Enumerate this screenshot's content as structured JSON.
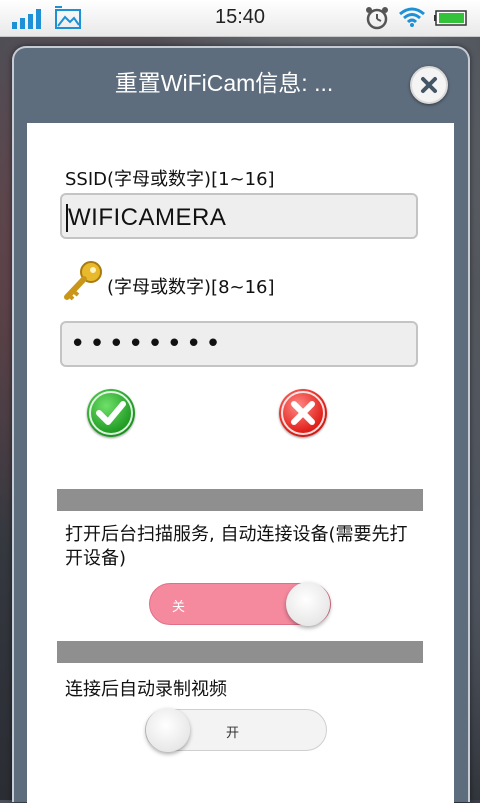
{
  "status_bar": {
    "time": "15:40",
    "icons": [
      "signal-icon",
      "image-icon",
      "alarm-icon",
      "wifi-icon",
      "battery-icon"
    ]
  },
  "dialog": {
    "title": "重置WiFiCam信息: ...",
    "ssid_label": "SSID(字母或数字)[1~16]",
    "ssid_value": "WIFICAMERA",
    "password_label": "(字母或数字)[8~16]",
    "password_value": "••••••••",
    "confirm_icon": "check-icon",
    "cancel_icon": "cross-icon",
    "scan_service_label": "打开后台扫描服务, 自动连接设备(需要先打开设备)",
    "scan_service_toggle": {
      "state_label": "关",
      "on": false
    },
    "auto_record_label": "连接后自动录制视频",
    "auto_record_toggle": {
      "state_label": "开",
      "on": true
    }
  },
  "colors": {
    "dialog_header": "#5e6d7e",
    "toggle_off": "#f5899e",
    "confirm_green": "#1f9a22",
    "cancel_red": "#e2231d",
    "divider": "#8f8f8f",
    "status_icon_blue": "#1e90d6"
  }
}
